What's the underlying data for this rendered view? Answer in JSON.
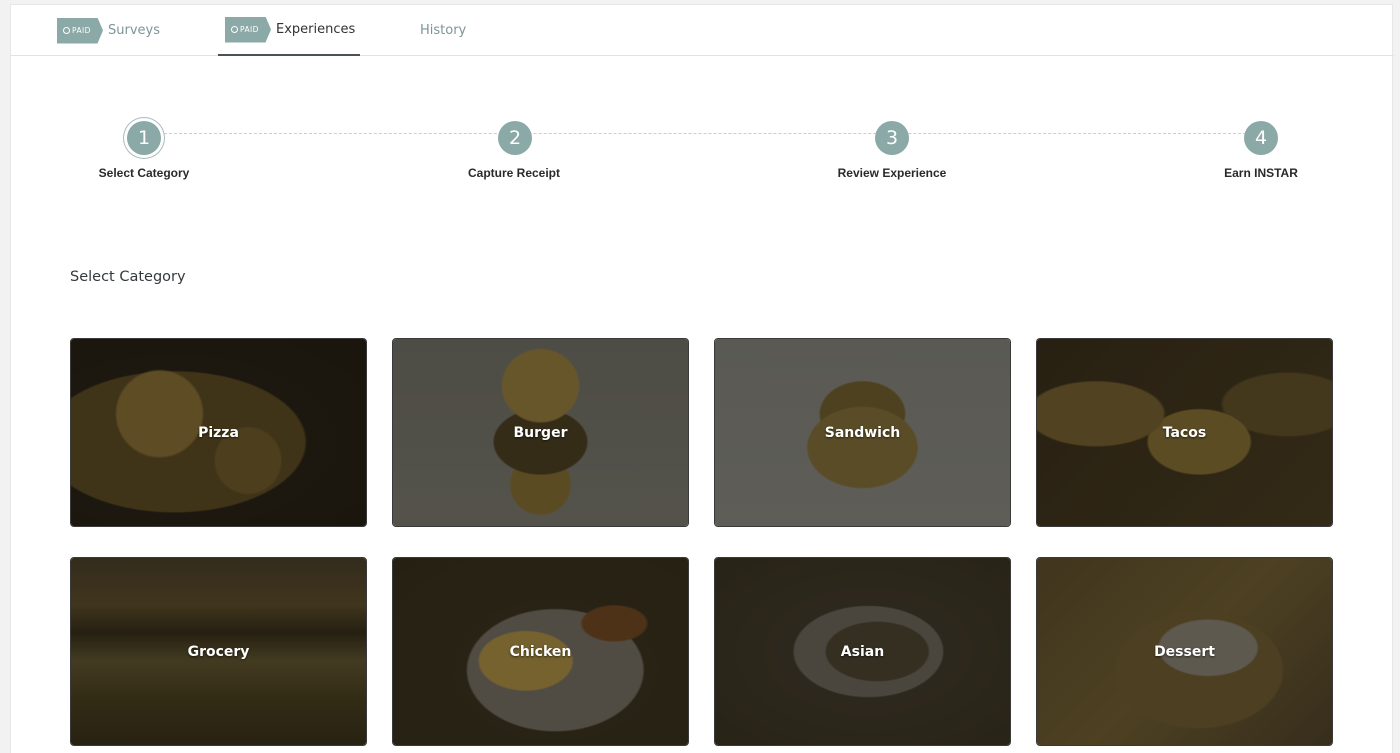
{
  "tabs": {
    "paid_badge": "PAID",
    "surveys": "Surveys",
    "experiences": "Experiences",
    "history": "History",
    "active": "Experiences"
  },
  "steps": [
    {
      "number": "1",
      "label": "Select Category"
    },
    {
      "number": "2",
      "label": "Capture Receipt"
    },
    {
      "number": "3",
      "label": "Review Experience"
    },
    {
      "number": "4",
      "label": "Earn INSTAR"
    }
  ],
  "section_title": "Select Category",
  "categories": [
    "Pizza",
    "Burger",
    "Sandwich",
    "Tacos",
    "Grocery",
    "Chicken",
    "Asian",
    "Dessert"
  ],
  "colors": {
    "accent": "#8ba9a7",
    "tab_inactive": "#7d9596",
    "tab_active": "#2f3336"
  }
}
